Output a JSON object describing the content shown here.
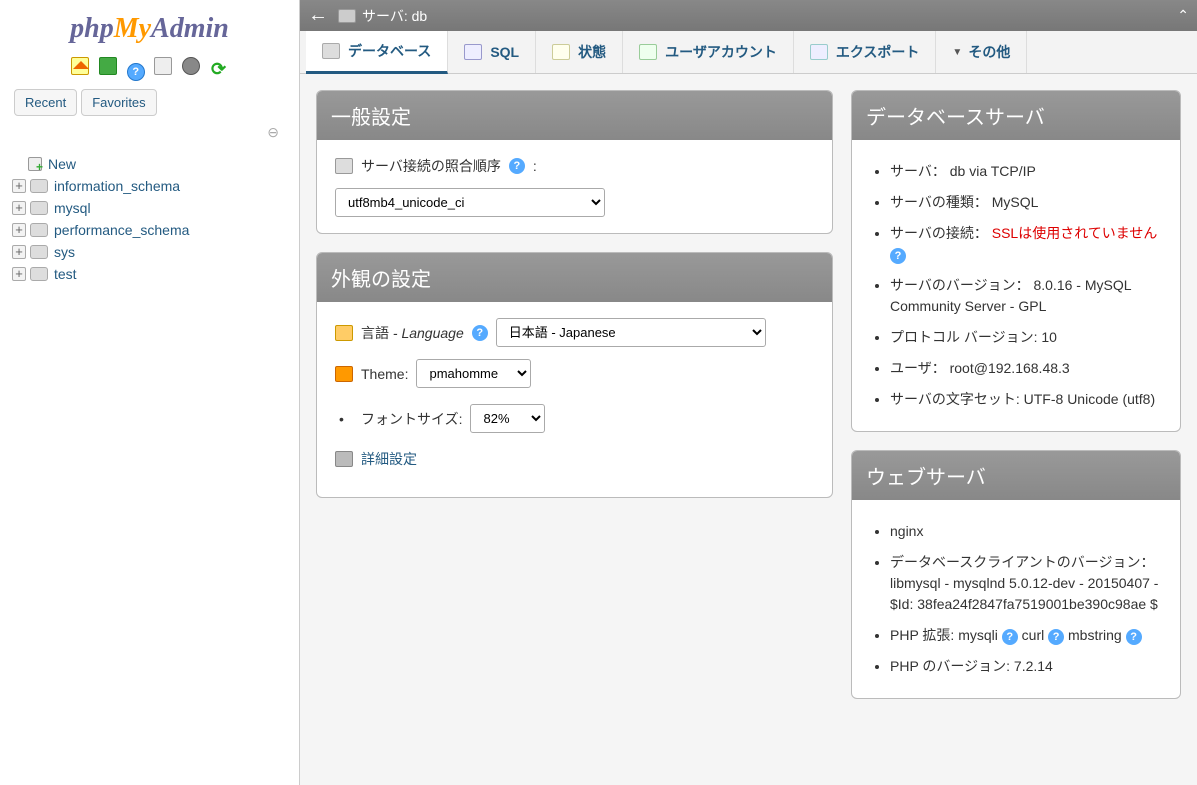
{
  "logo": {
    "php": "php",
    "my": "My",
    "admin": "Admin"
  },
  "sidebar": {
    "tabs": {
      "recent": "Recent",
      "favorites": "Favorites"
    },
    "new_label": "New",
    "databases": [
      {
        "name": "information_schema"
      },
      {
        "name": "mysql"
      },
      {
        "name": "performance_schema"
      },
      {
        "name": "sys"
      },
      {
        "name": "test"
      }
    ]
  },
  "topbar": {
    "server_label": "サーバ: db"
  },
  "main_tabs": {
    "databases": "データベース",
    "sql": "SQL",
    "status": "状態",
    "users": "ユーザアカウント",
    "export": "エクスポート",
    "more": "その他"
  },
  "general": {
    "title": "一般設定",
    "collation_label": "サーバ接続の照合順序",
    "collation_value": "utf8mb4_unicode_ci"
  },
  "appearance": {
    "title": "外観の設定",
    "lang_label_jp": "言語",
    "lang_label_en": " - Language",
    "lang_value": "日本語 - Japanese",
    "theme_label": "Theme:",
    "theme_value": "pmahomme",
    "font_label": "フォントサイズ:",
    "font_value": "82%",
    "more_settings": "詳細設定"
  },
  "db_server": {
    "title": "データベースサーバ",
    "items": {
      "server": "サーバ：  db via TCP/IP",
      "type": "サーバの種類：  MySQL",
      "conn_label": "サーバの接続：  ",
      "conn_warn": "SSLは使用されていません",
      "version": "サーバのバージョン：  8.0.16 - MySQL Community Server - GPL",
      "protocol": "プロトコル バージョン: 10",
      "user": "ユーザ：  root@192.168.48.3",
      "charset": "サーバの文字セット: UTF-8 Unicode (utf8)"
    }
  },
  "web_server": {
    "title": "ウェブサーバ",
    "items": {
      "nginx": "nginx",
      "client": "データベースクライアントのバージョン：  libmysql - mysqlnd 5.0.12-dev - 20150407 - $Id: 38fea24f2847fa7519001be390c98ae $",
      "ext_label": "PHP 拡張: mysqli ",
      "ext_curl": " curl ",
      "ext_mbstring": " mbstring ",
      "php_version": "PHP のバージョン: 7.2.14"
    }
  }
}
